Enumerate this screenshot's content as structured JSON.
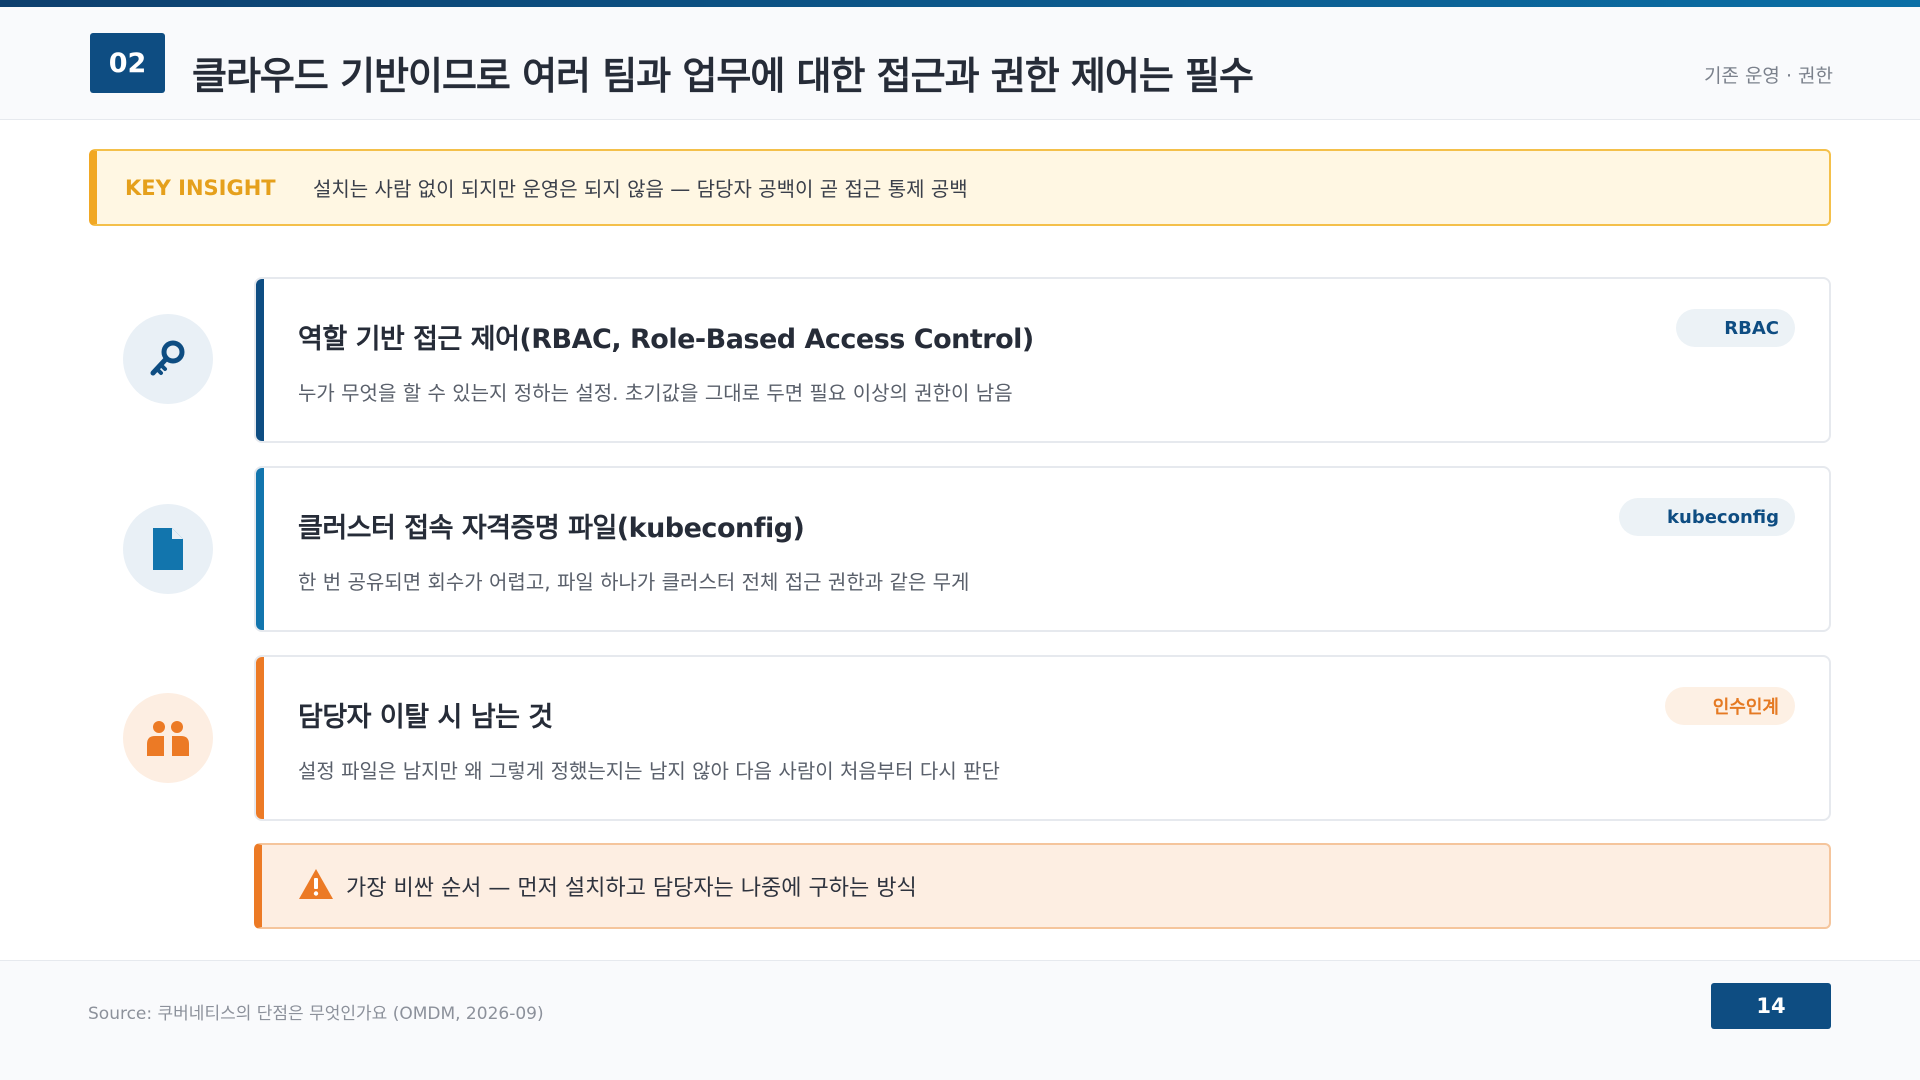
{
  "header": {
    "section_number": "02",
    "title": "클라우드 기반이므로 여러 팀과 업무에 대한 접근과 권한 제어는 필수",
    "tag": "기존 운영 · 권한"
  },
  "insight": {
    "label": "KEY INSIGHT",
    "text": "설치는 사람 없이 되지만 운영은 되지 않음 — 담당자 공백이 곧 접근 통제 공백"
  },
  "cards": [
    {
      "icon": "key-icon",
      "title": "역할 기반 접근 제어(RBAC, Role-Based Access Control)",
      "description": "누가 무엇을 할 수 있는지 정하는 설정. 초기값을 그대로 두면 필요 이상의 권한이 남음",
      "badge": "RBAC",
      "accent_color": "#0e4d82"
    },
    {
      "icon": "file-icon",
      "title": "클러스터 접속 자격증명 파일(kubeconfig)",
      "description": "한 번 공유되면 회수가 어렵고, 파일 하나가 클러스터 전체 접근 권한과 같은 무게",
      "badge": "kubeconfig",
      "accent_color": "#1275ad"
    },
    {
      "icon": "people-icon",
      "title": "담당자 이탈 시 남는 것",
      "description": "설정 파일은 남지만 왜 그렇게 정했는지는 남지 않아 다음 사람이 처음부터 다시 판단",
      "badge": "인수인계",
      "accent_color": "#ec7a25"
    }
  ],
  "warning": {
    "icon": "warning-icon",
    "text": "가장 비싼 순서 — 먼저 설치하고 담당자는 나중에 구하는 방식"
  },
  "footer": {
    "source": "Source: 쿠버네티스의 단점은 무엇인가요 (OMDM, 2026-09)",
    "page_number": "14"
  },
  "colors": {
    "primary": "#0e4d82",
    "insight_accent": "#f1a824",
    "warning_accent": "#ec7a25"
  }
}
